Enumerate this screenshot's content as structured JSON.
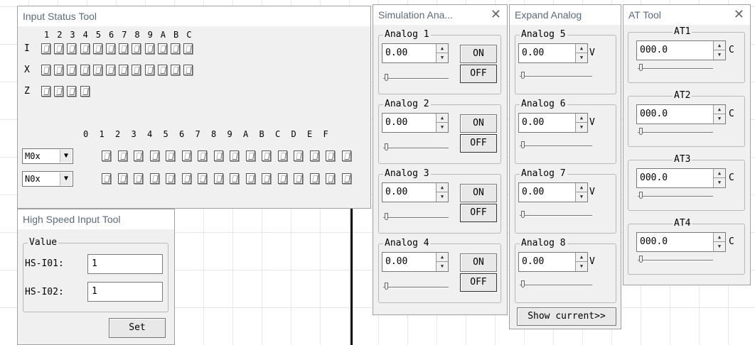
{
  "input_status": {
    "title": "Input Status Tool",
    "header1": [
      "1",
      "2",
      "3",
      "4",
      "5",
      "6",
      "7",
      "8",
      "9",
      "A",
      "B",
      "C"
    ],
    "rows": [
      {
        "label": "I",
        "count": 12
      },
      {
        "label": "X",
        "count": 12
      },
      {
        "label": "Z",
        "count": 4
      }
    ],
    "header2": [
      "0",
      "1",
      "2",
      "3",
      "4",
      "5",
      "6",
      "7",
      "8",
      "9",
      "A",
      "B",
      "C",
      "D",
      "E",
      "F"
    ],
    "selects": [
      "M0x",
      "N0x"
    ]
  },
  "high_speed": {
    "title": "High Speed Input Tool",
    "group_label": "Value",
    "fields": [
      {
        "label": "HS-I01:",
        "value": "1"
      },
      {
        "label": "HS-I02:",
        "value": "1"
      }
    ],
    "set_label": "Set"
  },
  "simulation_analog": {
    "title": "Simulation Ana...",
    "close_icon": "close-icon",
    "groups": [
      {
        "label": "Analog 1",
        "value": "0.00",
        "on": "ON",
        "off": "OFF"
      },
      {
        "label": "Analog 2",
        "value": "0.00",
        "on": "ON",
        "off": "OFF"
      },
      {
        "label": "Analog 3",
        "value": "0.00",
        "on": "ON",
        "off": "OFF"
      },
      {
        "label": "Analog 4",
        "value": "0.00",
        "on": "ON",
        "off": "OFF"
      }
    ]
  },
  "expand_analog": {
    "title": "Expand Analog",
    "unit": "V",
    "groups": [
      {
        "label": "Analog 5",
        "value": "0.00"
      },
      {
        "label": "Analog 6",
        "value": "0.00"
      },
      {
        "label": "Analog 7",
        "value": "0.00"
      },
      {
        "label": "Analog 8",
        "value": "0.00"
      }
    ],
    "show_current": "Show current>>"
  },
  "at_tool": {
    "title": "AT Tool",
    "unit": "C",
    "groups": [
      {
        "label": "AT1",
        "value": "000.0"
      },
      {
        "label": "AT2",
        "value": "000.0"
      },
      {
        "label": "AT3",
        "value": "000.0"
      },
      {
        "label": "AT4",
        "value": "000.0"
      }
    ]
  }
}
